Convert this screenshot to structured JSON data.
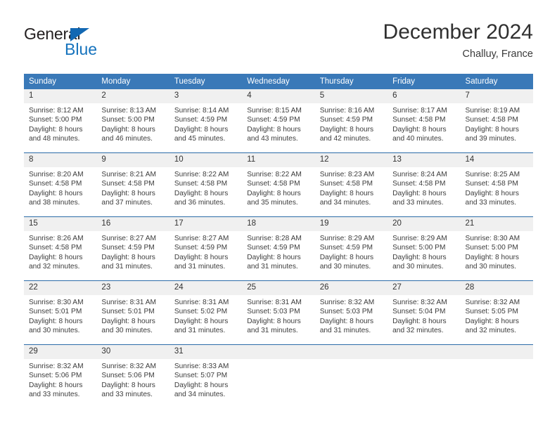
{
  "brand": {
    "name_part1": "General",
    "name_part2": "Blue",
    "accent_color": "#1673bd"
  },
  "header": {
    "title": "December 2024",
    "location": "Challuy, France"
  },
  "calendar": {
    "header_bg_color": "#3a79b8",
    "daynum_bg_color": "#f0f0f0",
    "weekday_headers": [
      "Sunday",
      "Monday",
      "Tuesday",
      "Wednesday",
      "Thursday",
      "Friday",
      "Saturday"
    ],
    "weeks": [
      [
        {
          "day": "1",
          "sunrise": "Sunrise: 8:12 AM",
          "sunset": "Sunset: 5:00 PM",
          "daylight1": "Daylight: 8 hours",
          "daylight2": "and 48 minutes."
        },
        {
          "day": "2",
          "sunrise": "Sunrise: 8:13 AM",
          "sunset": "Sunset: 5:00 PM",
          "daylight1": "Daylight: 8 hours",
          "daylight2": "and 46 minutes."
        },
        {
          "day": "3",
          "sunrise": "Sunrise: 8:14 AM",
          "sunset": "Sunset: 4:59 PM",
          "daylight1": "Daylight: 8 hours",
          "daylight2": "and 45 minutes."
        },
        {
          "day": "4",
          "sunrise": "Sunrise: 8:15 AM",
          "sunset": "Sunset: 4:59 PM",
          "daylight1": "Daylight: 8 hours",
          "daylight2": "and 43 minutes."
        },
        {
          "day": "5",
          "sunrise": "Sunrise: 8:16 AM",
          "sunset": "Sunset: 4:59 PM",
          "daylight1": "Daylight: 8 hours",
          "daylight2": "and 42 minutes."
        },
        {
          "day": "6",
          "sunrise": "Sunrise: 8:17 AM",
          "sunset": "Sunset: 4:58 PM",
          "daylight1": "Daylight: 8 hours",
          "daylight2": "and 40 minutes."
        },
        {
          "day": "7",
          "sunrise": "Sunrise: 8:19 AM",
          "sunset": "Sunset: 4:58 PM",
          "daylight1": "Daylight: 8 hours",
          "daylight2": "and 39 minutes."
        }
      ],
      [
        {
          "day": "8",
          "sunrise": "Sunrise: 8:20 AM",
          "sunset": "Sunset: 4:58 PM",
          "daylight1": "Daylight: 8 hours",
          "daylight2": "and 38 minutes."
        },
        {
          "day": "9",
          "sunrise": "Sunrise: 8:21 AM",
          "sunset": "Sunset: 4:58 PM",
          "daylight1": "Daylight: 8 hours",
          "daylight2": "and 37 minutes."
        },
        {
          "day": "10",
          "sunrise": "Sunrise: 8:22 AM",
          "sunset": "Sunset: 4:58 PM",
          "daylight1": "Daylight: 8 hours",
          "daylight2": "and 36 minutes."
        },
        {
          "day": "11",
          "sunrise": "Sunrise: 8:22 AM",
          "sunset": "Sunset: 4:58 PM",
          "daylight1": "Daylight: 8 hours",
          "daylight2": "and 35 minutes."
        },
        {
          "day": "12",
          "sunrise": "Sunrise: 8:23 AM",
          "sunset": "Sunset: 4:58 PM",
          "daylight1": "Daylight: 8 hours",
          "daylight2": "and 34 minutes."
        },
        {
          "day": "13",
          "sunrise": "Sunrise: 8:24 AM",
          "sunset": "Sunset: 4:58 PM",
          "daylight1": "Daylight: 8 hours",
          "daylight2": "and 33 minutes."
        },
        {
          "day": "14",
          "sunrise": "Sunrise: 8:25 AM",
          "sunset": "Sunset: 4:58 PM",
          "daylight1": "Daylight: 8 hours",
          "daylight2": "and 33 minutes."
        }
      ],
      [
        {
          "day": "15",
          "sunrise": "Sunrise: 8:26 AM",
          "sunset": "Sunset: 4:58 PM",
          "daylight1": "Daylight: 8 hours",
          "daylight2": "and 32 minutes."
        },
        {
          "day": "16",
          "sunrise": "Sunrise: 8:27 AM",
          "sunset": "Sunset: 4:59 PM",
          "daylight1": "Daylight: 8 hours",
          "daylight2": "and 31 minutes."
        },
        {
          "day": "17",
          "sunrise": "Sunrise: 8:27 AM",
          "sunset": "Sunset: 4:59 PM",
          "daylight1": "Daylight: 8 hours",
          "daylight2": "and 31 minutes."
        },
        {
          "day": "18",
          "sunrise": "Sunrise: 8:28 AM",
          "sunset": "Sunset: 4:59 PM",
          "daylight1": "Daylight: 8 hours",
          "daylight2": "and 31 minutes."
        },
        {
          "day": "19",
          "sunrise": "Sunrise: 8:29 AM",
          "sunset": "Sunset: 4:59 PM",
          "daylight1": "Daylight: 8 hours",
          "daylight2": "and 30 minutes."
        },
        {
          "day": "20",
          "sunrise": "Sunrise: 8:29 AM",
          "sunset": "Sunset: 5:00 PM",
          "daylight1": "Daylight: 8 hours",
          "daylight2": "and 30 minutes."
        },
        {
          "day": "21",
          "sunrise": "Sunrise: 8:30 AM",
          "sunset": "Sunset: 5:00 PM",
          "daylight1": "Daylight: 8 hours",
          "daylight2": "and 30 minutes."
        }
      ],
      [
        {
          "day": "22",
          "sunrise": "Sunrise: 8:30 AM",
          "sunset": "Sunset: 5:01 PM",
          "daylight1": "Daylight: 8 hours",
          "daylight2": "and 30 minutes."
        },
        {
          "day": "23",
          "sunrise": "Sunrise: 8:31 AM",
          "sunset": "Sunset: 5:01 PM",
          "daylight1": "Daylight: 8 hours",
          "daylight2": "and 30 minutes."
        },
        {
          "day": "24",
          "sunrise": "Sunrise: 8:31 AM",
          "sunset": "Sunset: 5:02 PM",
          "daylight1": "Daylight: 8 hours",
          "daylight2": "and 31 minutes."
        },
        {
          "day": "25",
          "sunrise": "Sunrise: 8:31 AM",
          "sunset": "Sunset: 5:03 PM",
          "daylight1": "Daylight: 8 hours",
          "daylight2": "and 31 minutes."
        },
        {
          "day": "26",
          "sunrise": "Sunrise: 8:32 AM",
          "sunset": "Sunset: 5:03 PM",
          "daylight1": "Daylight: 8 hours",
          "daylight2": "and 31 minutes."
        },
        {
          "day": "27",
          "sunrise": "Sunrise: 8:32 AM",
          "sunset": "Sunset: 5:04 PM",
          "daylight1": "Daylight: 8 hours",
          "daylight2": "and 32 minutes."
        },
        {
          "day": "28",
          "sunrise": "Sunrise: 8:32 AM",
          "sunset": "Sunset: 5:05 PM",
          "daylight1": "Daylight: 8 hours",
          "daylight2": "and 32 minutes."
        }
      ],
      [
        {
          "day": "29",
          "sunrise": "Sunrise: 8:32 AM",
          "sunset": "Sunset: 5:06 PM",
          "daylight1": "Daylight: 8 hours",
          "daylight2": "and 33 minutes."
        },
        {
          "day": "30",
          "sunrise": "Sunrise: 8:32 AM",
          "sunset": "Sunset: 5:06 PM",
          "daylight1": "Daylight: 8 hours",
          "daylight2": "and 33 minutes."
        },
        {
          "day": "31",
          "sunrise": "Sunrise: 8:33 AM",
          "sunset": "Sunset: 5:07 PM",
          "daylight1": "Daylight: 8 hours",
          "daylight2": "and 34 minutes."
        },
        {
          "day": "",
          "sunrise": "",
          "sunset": "",
          "daylight1": "",
          "daylight2": ""
        },
        {
          "day": "",
          "sunrise": "",
          "sunset": "",
          "daylight1": "",
          "daylight2": ""
        },
        {
          "day": "",
          "sunrise": "",
          "sunset": "",
          "daylight1": "",
          "daylight2": ""
        },
        {
          "day": "",
          "sunrise": "",
          "sunset": "",
          "daylight1": "",
          "daylight2": ""
        }
      ]
    ]
  }
}
